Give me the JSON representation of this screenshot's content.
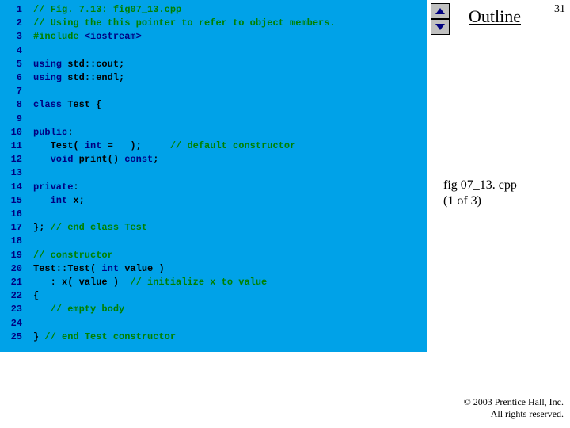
{
  "outline_label": "Outline",
  "page_number": "31",
  "file_label_line1": "fig 07_13. cpp",
  "file_label_line2": "(1 of 3)",
  "copyright_line1": "© 2003 Prentice Hall, Inc.",
  "copyright_line2": "All rights reserved.",
  "lines": [
    {
      "n": "1",
      "spans": [
        {
          "cls": "c-comment",
          "t": "// Fig. 7.13: fig07_13.cpp"
        }
      ]
    },
    {
      "n": "2",
      "spans": [
        {
          "cls": "c-comment",
          "t": "// Using the this pointer to refer to object members."
        }
      ]
    },
    {
      "n": "3",
      "spans": [
        {
          "cls": "c-pp",
          "t": "#include "
        },
        {
          "cls": "c-kw",
          "t": "<iostream>"
        }
      ]
    },
    {
      "n": "4",
      "spans": []
    },
    {
      "n": "5",
      "spans": [
        {
          "cls": "c-kw",
          "t": "using "
        },
        {
          "cls": "c-plain",
          "t": "std::cout;"
        }
      ]
    },
    {
      "n": "6",
      "spans": [
        {
          "cls": "c-kw",
          "t": "using "
        },
        {
          "cls": "c-plain",
          "t": "std::endl;"
        }
      ]
    },
    {
      "n": "7",
      "spans": []
    },
    {
      "n": "8",
      "spans": [
        {
          "cls": "c-kw",
          "t": "class "
        },
        {
          "cls": "c-plain",
          "t": "Test {"
        }
      ]
    },
    {
      "n": "9",
      "spans": []
    },
    {
      "n": "10",
      "spans": [
        {
          "cls": "c-kw",
          "t": "public"
        },
        {
          "cls": "c-plain",
          "t": ":"
        }
      ]
    },
    {
      "n": "11",
      "spans": [
        {
          "cls": "c-plain",
          "t": "   Test( "
        },
        {
          "cls": "c-kw",
          "t": "int"
        },
        {
          "cls": "c-plain",
          "t": " =   );     "
        },
        {
          "cls": "c-comment",
          "t": "// default constructor"
        }
      ]
    },
    {
      "n": "12",
      "spans": [
        {
          "cls": "c-plain",
          "t": "   "
        },
        {
          "cls": "c-kw",
          "t": "void"
        },
        {
          "cls": "c-plain",
          "t": " print() "
        },
        {
          "cls": "c-kw",
          "t": "const"
        },
        {
          "cls": "c-plain",
          "t": ";"
        }
      ]
    },
    {
      "n": "13",
      "spans": []
    },
    {
      "n": "14",
      "spans": [
        {
          "cls": "c-kw",
          "t": "private"
        },
        {
          "cls": "c-plain",
          "t": ":"
        }
      ]
    },
    {
      "n": "15",
      "spans": [
        {
          "cls": "c-plain",
          "t": "   "
        },
        {
          "cls": "c-kw",
          "t": "int"
        },
        {
          "cls": "c-plain",
          "t": " x;"
        }
      ]
    },
    {
      "n": "16",
      "spans": []
    },
    {
      "n": "17",
      "spans": [
        {
          "cls": "c-plain",
          "t": "}; "
        },
        {
          "cls": "c-comment",
          "t": "// end class Test"
        }
      ]
    },
    {
      "n": "18",
      "spans": []
    },
    {
      "n": "19",
      "spans": [
        {
          "cls": "c-comment",
          "t": "// constructor"
        }
      ]
    },
    {
      "n": "20",
      "spans": [
        {
          "cls": "c-plain",
          "t": "Test::Test( "
        },
        {
          "cls": "c-kw",
          "t": "int"
        },
        {
          "cls": "c-plain",
          "t": " value )"
        }
      ]
    },
    {
      "n": "21",
      "spans": [
        {
          "cls": "c-plain",
          "t": "   : x( value )  "
        },
        {
          "cls": "c-comment",
          "t": "// initialize x to value"
        }
      ]
    },
    {
      "n": "22",
      "spans": [
        {
          "cls": "c-plain",
          "t": "{"
        }
      ]
    },
    {
      "n": "23",
      "spans": [
        {
          "cls": "c-plain",
          "t": "   "
        },
        {
          "cls": "c-comment",
          "t": "// empty body"
        }
      ]
    },
    {
      "n": "24",
      "spans": []
    },
    {
      "n": "25",
      "spans": [
        {
          "cls": "c-plain",
          "t": "} "
        },
        {
          "cls": "c-comment",
          "t": "// end Test constructor"
        }
      ]
    }
  ]
}
